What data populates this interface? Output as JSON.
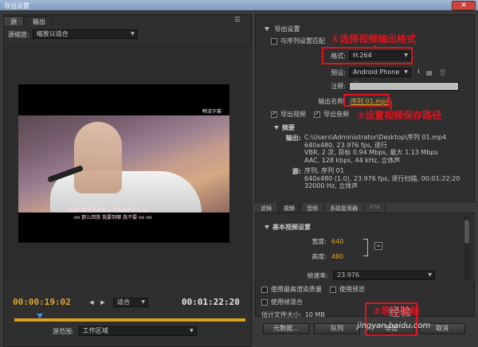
{
  "window": {
    "title": "导出设置",
    "close_icon": "close-icon"
  },
  "left": {
    "tabs": [
      "源",
      "输出"
    ],
    "active_tab": 1,
    "scale_label": "源缩放:",
    "scale_value": "缩放以适合",
    "video_watermark": "韩流字幕",
    "subtitle_line1": "我要到哪里得到什么 不会再谈千了 oo",
    "subtitle_line2": "oo 那么回我 我要到哪 我不要 oo oo",
    "timecode_start": "00:00:19:02",
    "timecode_end": "00:01:22:20",
    "fit_value": "适合",
    "range_label": "源范围:",
    "range_value": "工作区域"
  },
  "right": {
    "export_settings_label": "导出设置",
    "match_sequence_label": "与序列设置匹配",
    "format_label": "格式:",
    "format_value": "H.264",
    "preset_label": "预设:",
    "preset_value": "Android Phone ...",
    "comment_label": "注释:",
    "output_name_label": "输出名称:",
    "output_name_value": "序列 01.mp4",
    "export_video_label": "导出视频",
    "export_audio_label": "导出音频",
    "summary_label": "摘要",
    "summary_output_key": "输出:",
    "summary_output_lines": [
      "C:\\Users\\Administrator\\Desktop\\序列 01.mp4",
      "640x480, 23.976 fps, 逐行",
      "VBR, 2 次, 目标 0.94 Mbps, 最大 1.13 Mbps",
      "AAC, 128 kbps, 44 kHz, 立体声"
    ],
    "summary_source_key": "源:",
    "summary_source_lines": [
      "序列, 序列 01",
      "640x480 (1.0), 23.976 fps, 逐行扫描, 00:01:22:20",
      "32000 Hz, 立体声"
    ],
    "tabs": [
      "滤镜",
      "视频",
      "音频",
      "多路复用器",
      "FTP"
    ],
    "active_tab": 1,
    "basic_video_label": "基本视频设置",
    "width_label": "宽度:",
    "width_value": "640",
    "height_label": "高度:",
    "height_value": "480",
    "framerate_label": "帧速率:",
    "framerate_value": "23.976",
    "max_render_label": "使用最高渲染质量",
    "use_preview_label": "使用预览",
    "use_frame_blend_label": "使用帧混合",
    "file_size_label": "估计文件大小:",
    "file_size_value": "10 MB",
    "metadata_button": "元数据...",
    "queue_button": "队列",
    "export_button": "导出",
    "cancel_button": "取消"
  },
  "annotations": {
    "step1": "①选择视频输出格式",
    "step2": "②设置视频保存路径",
    "step3": "③导出视频"
  },
  "watermark": {
    "site": "jingyan.baidu.com",
    "logo_text": "经验"
  },
  "colors": {
    "accent_orange": "#e0a32a",
    "annotation_red": "#e0131f",
    "playhead_blue": "#4a8fe8"
  }
}
